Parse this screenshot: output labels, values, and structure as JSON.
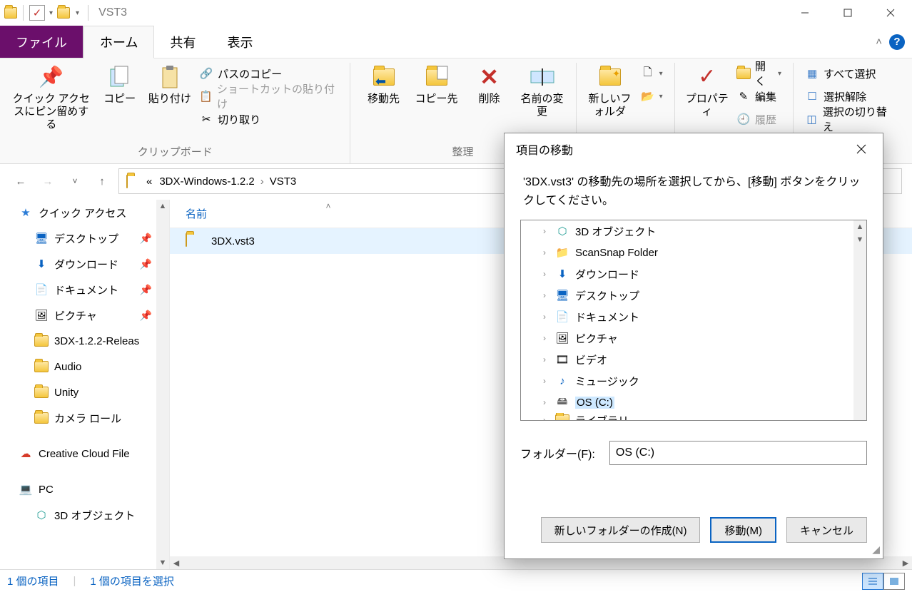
{
  "titlebar": {
    "title": "VST3"
  },
  "tabs": {
    "file": "ファイル",
    "home": "ホーム",
    "share": "共有",
    "view": "表示"
  },
  "ribbon": {
    "pin_to_quick": "クイック アクセスにピン留めする",
    "copy": "コピー",
    "paste": "貼り付け",
    "copy_path": "パスのコピー",
    "paste_shortcut": "ショートカットの貼り付け",
    "cut": "切り取り",
    "group_clipboard": "クリップボード",
    "move_to": "移動先",
    "copy_to": "コピー先",
    "delete": "削除",
    "rename": "名前の変更",
    "new_folder": "新しいフォルダ",
    "group_organize": "整理",
    "properties": "プロパティ",
    "open": "開く",
    "edit": "編集",
    "history": "履歴",
    "select_all": "すべて選択",
    "select_none": "選択解除",
    "invert_selection": "選択の切り替え"
  },
  "breadcrumb": {
    "prefix": "«",
    "p1": "3DX-Windows-1.2.2",
    "p2": "VST3"
  },
  "nav": {
    "quick_access": "クイック アクセス",
    "desktop": "デスクトップ",
    "downloads": "ダウンロード",
    "documents": "ドキュメント",
    "pictures": "ピクチャ",
    "f1": "3DX-1.2.2-Releas",
    "f2": "Audio",
    "f3": "Unity",
    "f4": "カメラ ロール",
    "cc": "Creative Cloud File",
    "pc": "PC",
    "pc_3d": "3D オブジェクト"
  },
  "filelist": {
    "col_name": "名前",
    "item1": "3DX.vst3"
  },
  "dialog": {
    "title": "項目の移動",
    "message": "'3DX.vst3' の移動先の場所を選択してから、[移動] ボタンをクリックしてください。",
    "nodes": {
      "n1": "3D オブジェクト",
      "n2": "ScanSnap Folder",
      "n3": "ダウンロード",
      "n4": "デスクトップ",
      "n5": "ドキュメント",
      "n6": "ピクチャ",
      "n7": "ビデオ",
      "n8": "ミュージック",
      "n9": "OS (C:)",
      "n10": "ライブラリ"
    },
    "folder_label": "フォルダー(F):",
    "folder_value": "OS (C:)",
    "new_folder": "新しいフォルダーの作成(N)",
    "move": "移動(M)",
    "cancel": "キャンセル"
  },
  "status": {
    "count": "1 個の項目",
    "selected": "1 個の項目を選択"
  }
}
